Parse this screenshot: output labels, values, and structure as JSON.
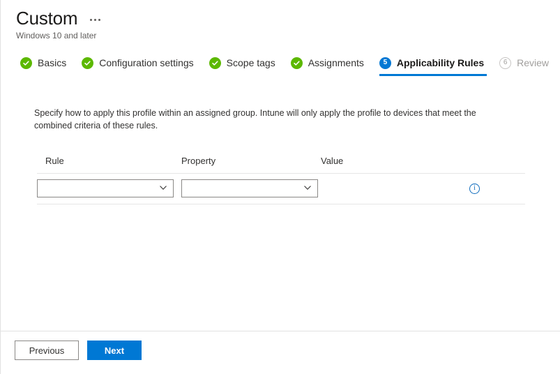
{
  "blade": {
    "title": "Custom",
    "subtitle": "Windows 10 and later",
    "more_actions_label": "More actions"
  },
  "wizard": {
    "steps": [
      {
        "label": "Basics",
        "state": "done",
        "indicator": "check-icon"
      },
      {
        "label": "Configuration settings",
        "state": "done",
        "indicator": "check-icon"
      },
      {
        "label": "Scope tags",
        "state": "done",
        "indicator": "check-icon"
      },
      {
        "label": "Assignments",
        "state": "done",
        "indicator": "check-icon"
      },
      {
        "label": "Applicability Rules",
        "state": "active",
        "indicator": "5"
      },
      {
        "label": "Review",
        "state": "disabled",
        "indicator": "6"
      }
    ]
  },
  "main": {
    "description": "Specify how to apply this profile within an assigned group. Intune will only apply the profile to devices that meet the combined criteria of these rules.",
    "table": {
      "columns": [
        "Rule",
        "Property",
        "Value"
      ],
      "rows": [
        {
          "rule": {
            "value": "",
            "placeholder": ""
          },
          "property": {
            "value": "",
            "placeholder": ""
          },
          "value": "",
          "info_icon": "info-icon"
        }
      ]
    }
  },
  "footer": {
    "previous_label": "Previous",
    "next_label": "Next"
  },
  "colors": {
    "accent": "#0078d4",
    "success": "#5cb800",
    "info": "#0f6cbd",
    "disabled_text": "#a19f9d",
    "border": "#e1e1e1"
  }
}
